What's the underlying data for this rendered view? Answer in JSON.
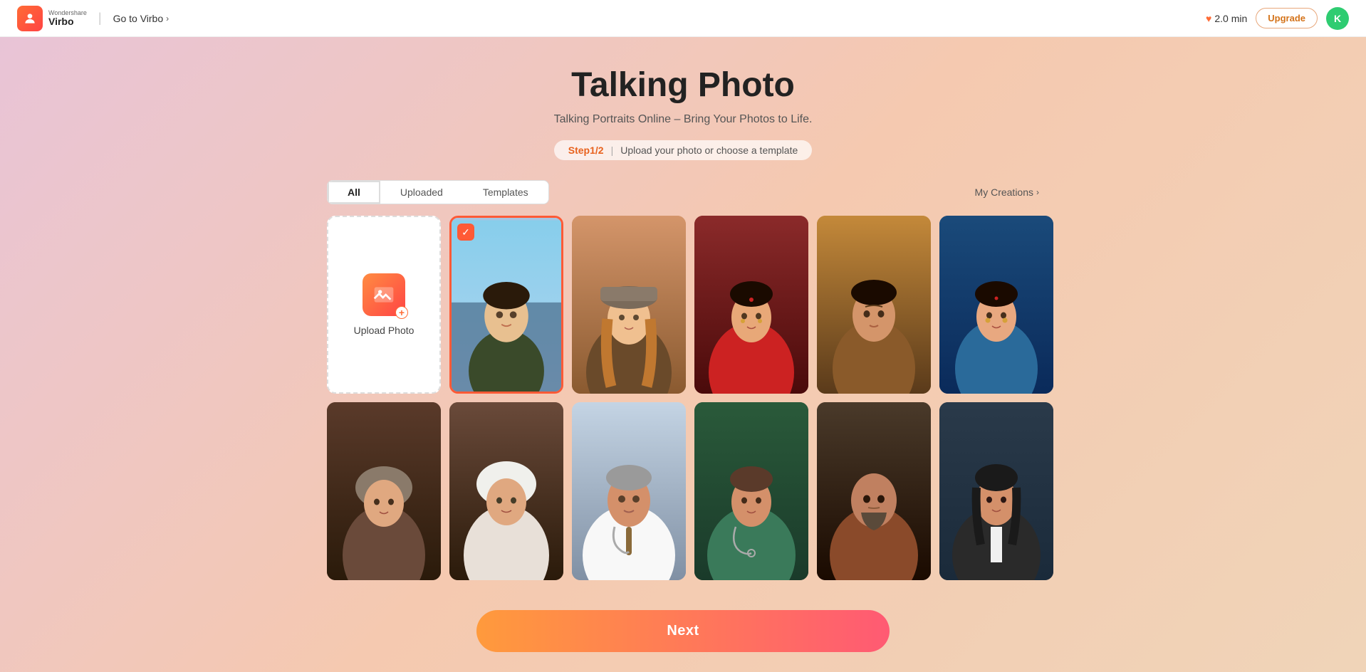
{
  "app": {
    "logo_wonder": "Wondershare",
    "logo_virbo": "Virbo",
    "goto_virbo": "Go to Virbo",
    "minutes": "2.0 min",
    "upgrade_label": "Upgrade",
    "avatar_letter": "K"
  },
  "page": {
    "title": "Talking Photo",
    "subtitle": "Talking Portraits Online – Bring Your Photos to Life.",
    "step_label": "Step1/2",
    "step_divider": "|",
    "step_desc": "Upload your photo or choose a template"
  },
  "tabs": {
    "all": "All",
    "uploaded": "Uploaded",
    "templates": "Templates",
    "my_creations": "My Creations"
  },
  "upload": {
    "label": "Upload Photo"
  },
  "next_button": "Next",
  "photos": [
    {
      "id": 1,
      "selected": true,
      "bg": "photo-bg-1",
      "sil": "sil-1"
    },
    {
      "id": 2,
      "selected": false,
      "bg": "photo-bg-2",
      "sil": "sil-2"
    },
    {
      "id": 3,
      "selected": false,
      "bg": "photo-bg-3",
      "sil": "sil-3"
    },
    {
      "id": 4,
      "selected": false,
      "bg": "photo-bg-4",
      "sil": "sil-4"
    },
    {
      "id": 5,
      "selected": false,
      "bg": "photo-bg-5",
      "sil": "sil-5"
    },
    {
      "id": 6,
      "selected": false,
      "bg": "photo-bg-6",
      "sil": "sil-6"
    },
    {
      "id": 7,
      "selected": false,
      "bg": "photo-bg-7",
      "sil": "sil-7"
    },
    {
      "id": 8,
      "selected": false,
      "bg": "photo-bg-8",
      "sil": "sil-8"
    },
    {
      "id": 9,
      "selected": false,
      "bg": "photo-bg-9",
      "sil": "sil-9"
    },
    {
      "id": 10,
      "selected": false,
      "bg": "photo-bg-10",
      "sil": "sil-10"
    },
    {
      "id": 11,
      "selected": false,
      "bg": "photo-bg-11",
      "sil": "sil-11"
    }
  ]
}
